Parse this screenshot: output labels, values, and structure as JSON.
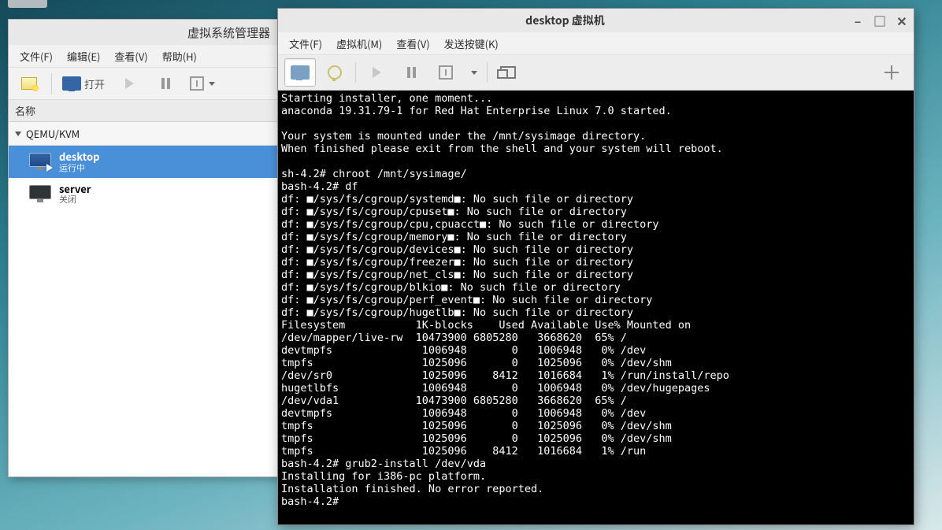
{
  "vmm": {
    "title": "虚拟系统管理器",
    "menus": {
      "file": "文件(F)",
      "edit": "编辑(E)",
      "view": "查看(V)",
      "help": "帮助(H)"
    },
    "toolbar": {
      "open_label": "打开"
    },
    "column_header": "名称",
    "host_label": "QEMU/KVM",
    "vms": [
      {
        "name": "desktop",
        "state": "运行中",
        "running": true,
        "selected": true
      },
      {
        "name": "server",
        "state": "关闭",
        "running": false,
        "selected": false
      }
    ]
  },
  "console": {
    "title": "desktop 虚拟机",
    "menus": {
      "file": "文件(F)",
      "vm": "虚拟机(M)",
      "view": "查看(V)",
      "sendkey": "发送按键(K)"
    },
    "terminal_text": "Starting installer, one moment...\nanaconda 19.31.79-1 for Red Hat Enterprise Linux 7.0 started.\n\nYour system is mounted under the /mnt/sysimage directory.\nWhen finished please exit from the shell and your system will reboot.\n\nsh-4.2# chroot /mnt/sysimage/\nbash-4.2# df\ndf: ■/sys/fs/cgroup/systemd■: No such file or directory\ndf: ■/sys/fs/cgroup/cpuset■: No such file or directory\ndf: ■/sys/fs/cgroup/cpu,cpuacct■: No such file or directory\ndf: ■/sys/fs/cgroup/memory■: No such file or directory\ndf: ■/sys/fs/cgroup/devices■: No such file or directory\ndf: ■/sys/fs/cgroup/freezer■: No such file or directory\ndf: ■/sys/fs/cgroup/net_cls■: No such file or directory\ndf: ■/sys/fs/cgroup/blkio■: No such file or directory\ndf: ■/sys/fs/cgroup/perf_event■: No such file or directory\ndf: ■/sys/fs/cgroup/hugetlb■: No such file or directory\nFilesystem           1K-blocks    Used Available Use% Mounted on\n/dev/mapper/live-rw  10473900 6805280   3668620  65% /\ndevtmpfs              1006948       0   1006948   0% /dev\ntmpfs                 1025096       0   1025096   0% /dev/shm\n/dev/sr0              1025096    8412   1016684   1% /run/install/repo\nhugetlbfs             1006948       0   1006948   0% /dev/hugepages\n/dev/vda1            10473900 6805280   3668620  65% /\ndevtmpfs              1006948       0   1006948   0% /dev\ntmpfs                 1025096       0   1025096   0% /dev/shm\ntmpfs                 1025096       0   1025096   0% /dev/shm\ntmpfs                 1025096    8412   1016684   1% /run\nbash-4.2# grub2-install /dev/vda\nInstalling for i386-pc platform.\nInstallation finished. No error reported.\nbash-4.2# "
  }
}
